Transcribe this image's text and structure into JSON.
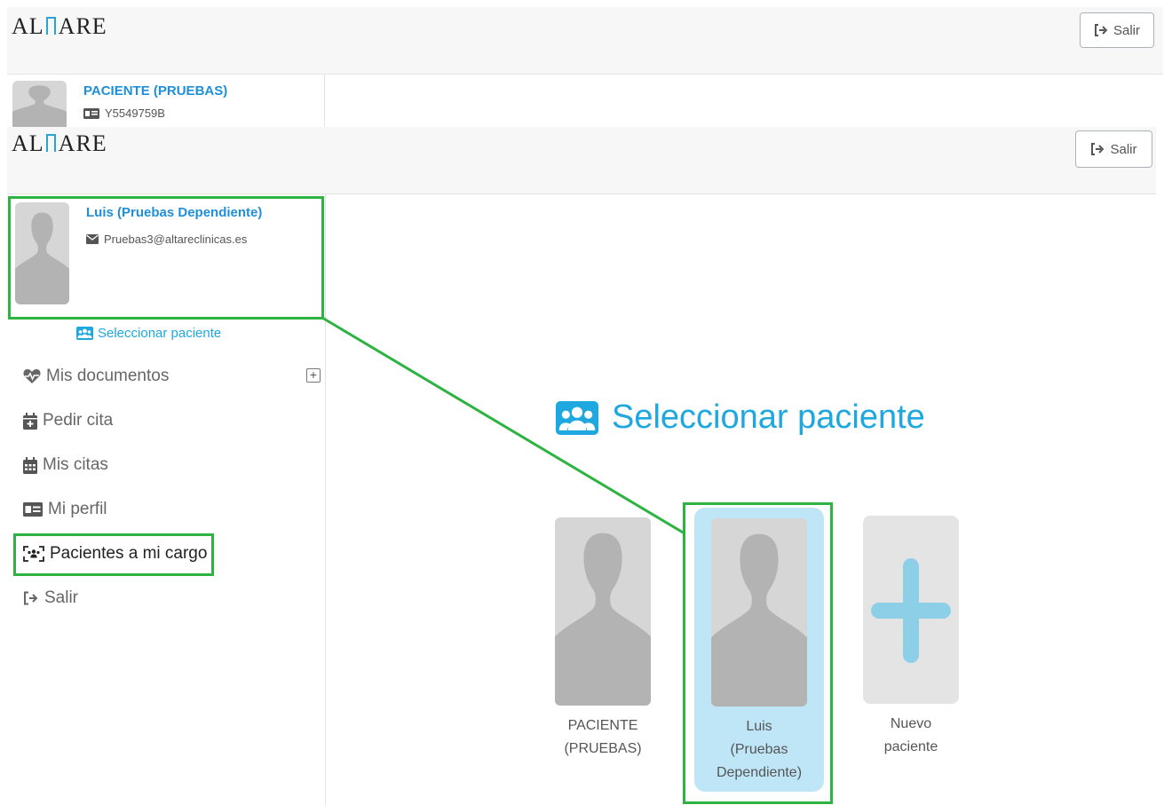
{
  "background_screen": {
    "logo": {
      "prefix": "AL",
      "suffix": "ARE"
    },
    "logout_label": "Salir",
    "patient": {
      "name": "PACIENTE (PRUEBAS)",
      "id_number": "Y5549759B"
    }
  },
  "header": {
    "logo": {
      "prefix": "AL",
      "suffix": "ARE"
    },
    "logout_label": "Salir"
  },
  "sidebar": {
    "user": {
      "name": "Luis (Pruebas Dependiente)",
      "email": "Pruebas3@altareclinicas.es"
    },
    "select_patient_link": "Seleccionar paciente",
    "menu": {
      "documents": "Mis documentos",
      "appointment": "Pedir cita",
      "my_appointments": "Mis citas",
      "profile": "Mi perfil",
      "patients": "Pacientes a mi cargo",
      "logout": "Salir"
    }
  },
  "main": {
    "title": "Seleccionar paciente",
    "cards": {
      "patient1": {
        "line1": "PACIENTE",
        "line2": "(PRUEBAS)"
      },
      "patient2": {
        "line1": "Luis",
        "line2": "(Pruebas",
        "line3": "Dependiente)"
      },
      "new": {
        "line1": "Nuevo",
        "line2": "paciente"
      }
    }
  },
  "colors": {
    "accent": "#1ea8df",
    "highlight": "#2db341",
    "selected_card": "#bfe6f7",
    "avatar_bg": "#d6d6d6"
  },
  "icons": [
    "sign-out-icon",
    "id-card-icon",
    "envelope-icon",
    "users-icon",
    "heartbeat-icon",
    "calendar-plus-icon",
    "calendar-icon",
    "user-scan-icon",
    "plus-icon"
  ]
}
